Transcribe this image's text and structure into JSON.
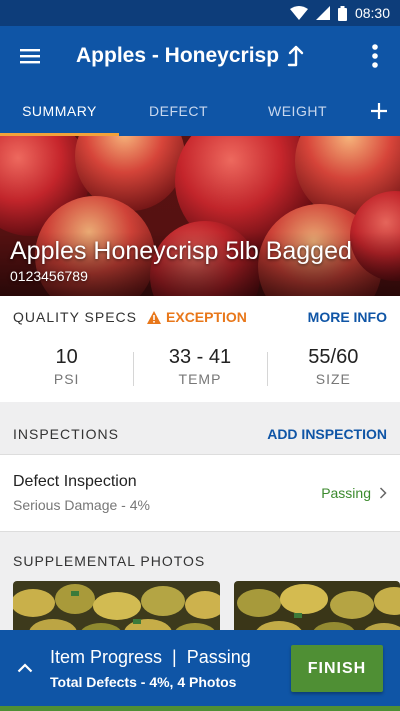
{
  "status_bar": {
    "time": "08:30",
    "icons": [
      "wifi-icon",
      "signal-icon",
      "battery-icon"
    ]
  },
  "app_bar": {
    "title": "Apples - Honeycrisp",
    "icons": [
      "menu-icon",
      "upload-arrow-icon",
      "more-vert-icon"
    ]
  },
  "tabs": [
    {
      "label": "SUMMARY",
      "active": true
    },
    {
      "label": "DEFECT",
      "active": false
    },
    {
      "label": "WEIGHT",
      "active": false
    }
  ],
  "hero": {
    "title": "Apples Honeycrisp 5lb Bagged",
    "sku": "0123456789"
  },
  "quality_specs": {
    "heading": "QUALITY SPECS",
    "exception_label": "EXCEPTION",
    "more_info": "MORE INFO",
    "items": [
      {
        "value": "10",
        "label": "PSI"
      },
      {
        "value": "33 - 41",
        "label": "TEMP"
      },
      {
        "value": "55/60",
        "label": "SIZE"
      }
    ]
  },
  "inspections": {
    "heading": "INSPECTIONS",
    "add_label": "ADD INSPECTION",
    "items": [
      {
        "title": "Defect Inspection",
        "subtitle": "Serious Damage - 4%",
        "status": "Passing"
      }
    ]
  },
  "supplemental_photos": {
    "heading": "SUPPLEMENTAL PHOTOS"
  },
  "bottom_bar": {
    "progress_label": "Item Progress",
    "separator": "|",
    "progress_status": "Passing",
    "summary": "Total Defects - 4%, 4 Photos",
    "finish_label": "FINISH"
  },
  "colors": {
    "primary": "#0f55a6",
    "status_bar": "#0d3d7a",
    "tab_indicator": "#f2a23a",
    "exception": "#e8771a",
    "passing": "#3c8a2e",
    "finish_button": "#4f8f34"
  }
}
